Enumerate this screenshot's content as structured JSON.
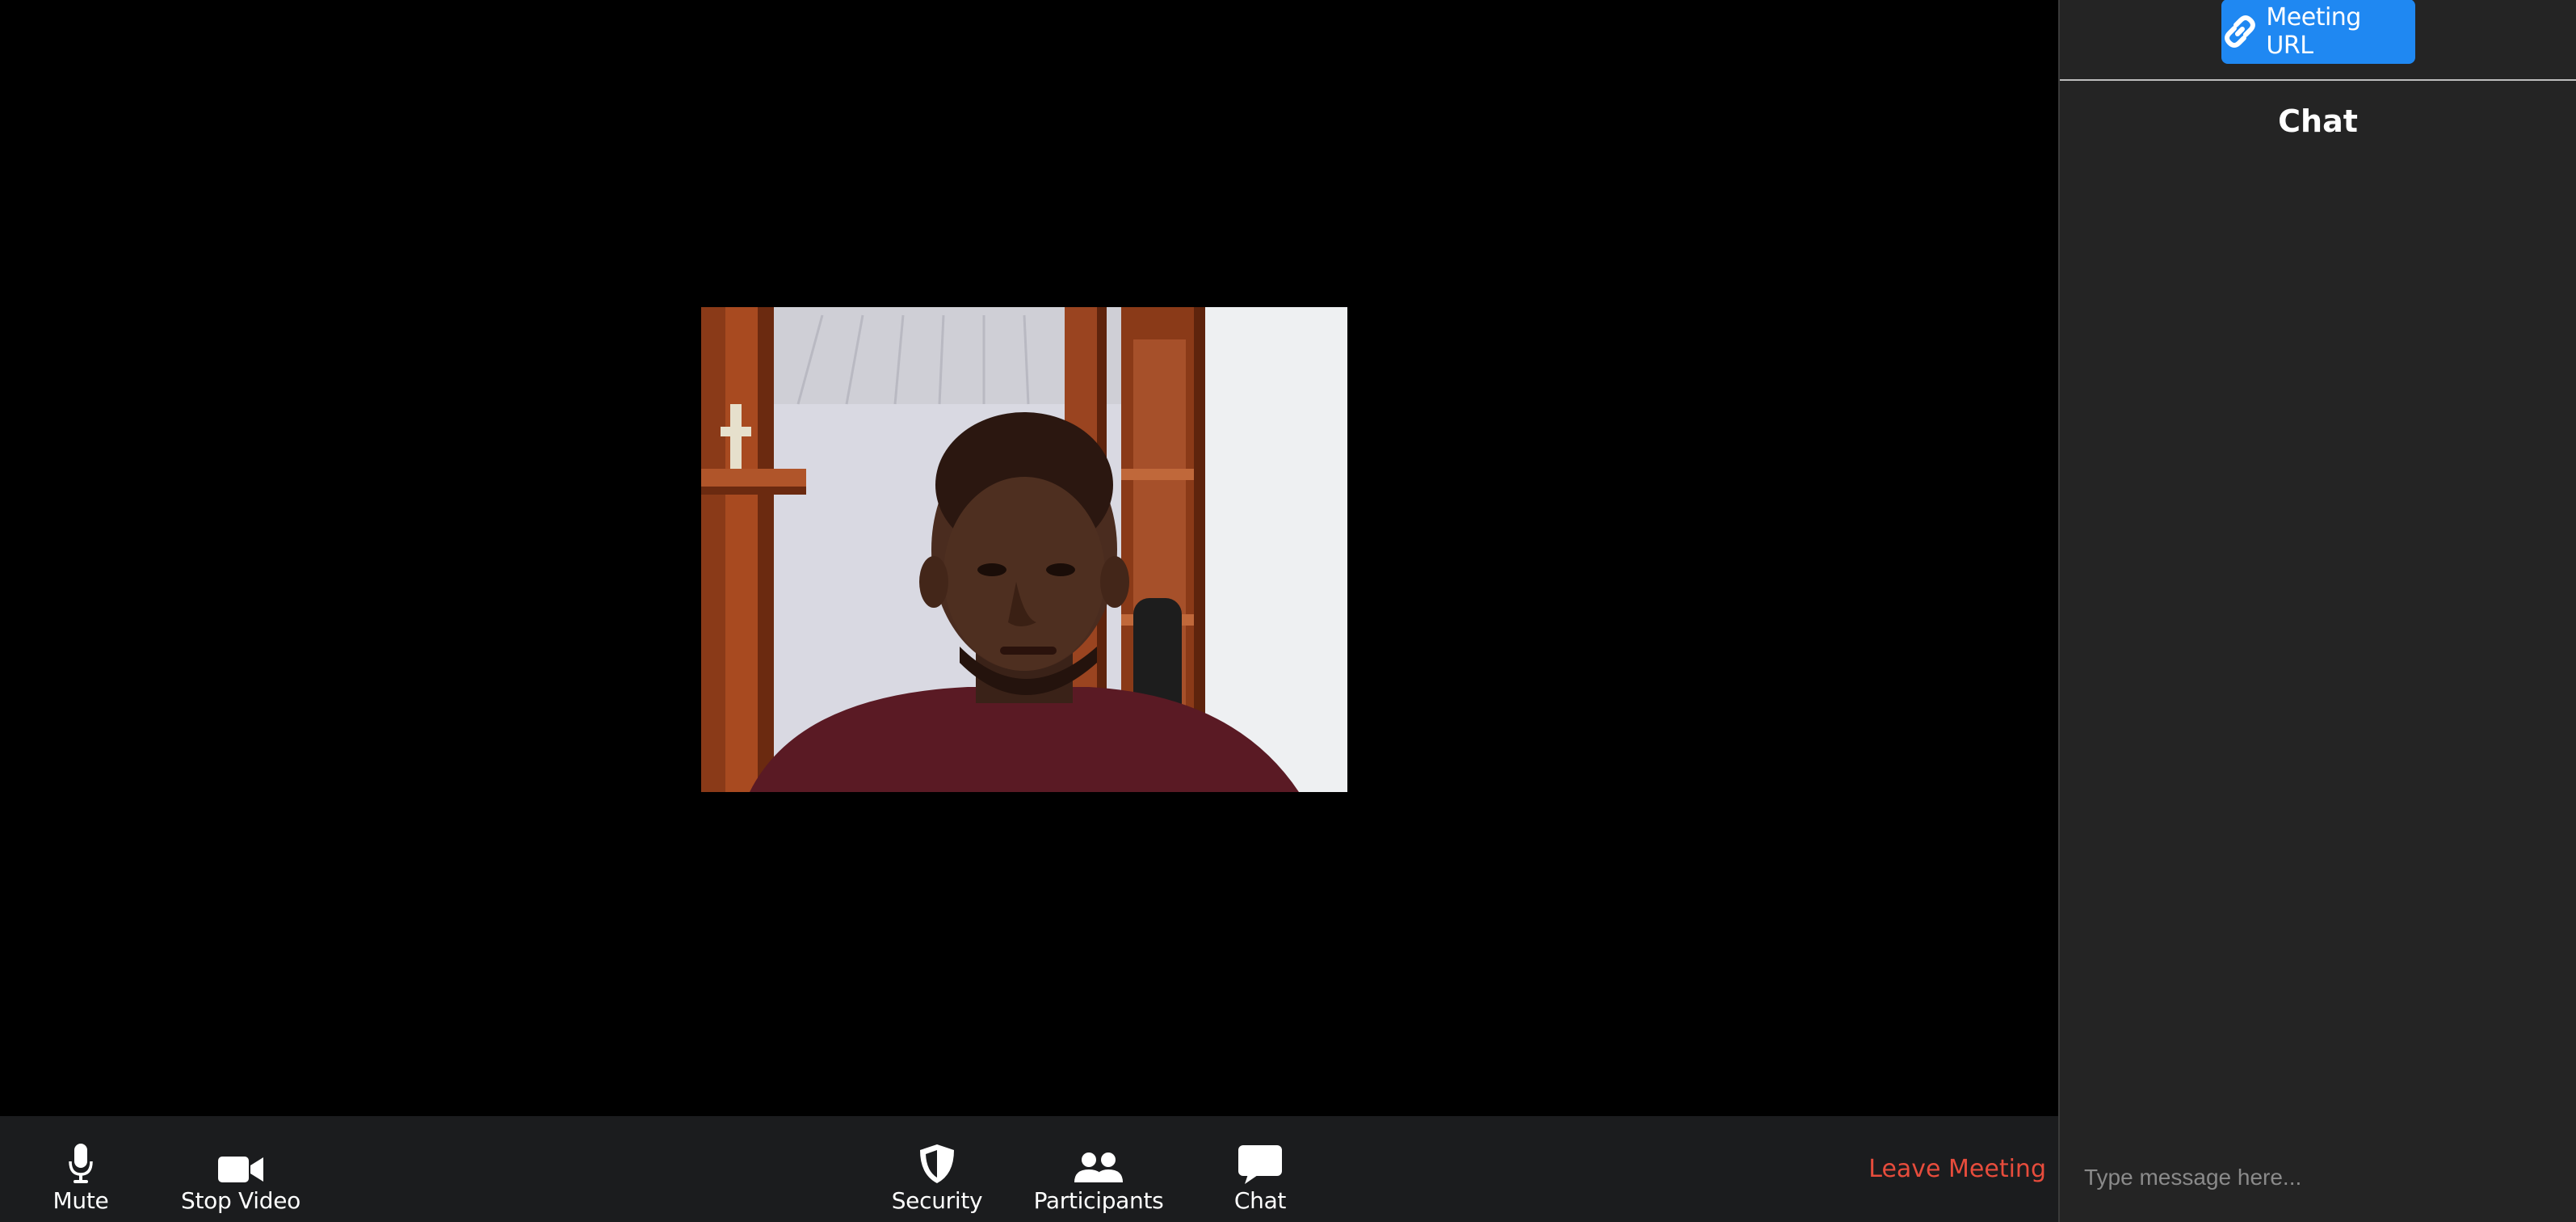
{
  "toolbar": {
    "left": [
      {
        "label": "Mute",
        "icon": "microphone-icon"
      },
      {
        "label": "Stop Video",
        "icon": "video-camera-icon"
      }
    ],
    "center": [
      {
        "label": "Security",
        "icon": "shield-icon"
      },
      {
        "label": "Participants",
        "icon": "users-icon"
      },
      {
        "label": "Chat",
        "icon": "chat-bubble-icon"
      }
    ],
    "leave_label": "Leave Meeting",
    "leave_color": "#e74c3c"
  },
  "panel": {
    "meeting_url_label": "Meeting URL",
    "meeting_url_icon": "link-icon",
    "meeting_url_color": "#1f88f2",
    "chat_title": "Chat",
    "input_placeholder": "Type message here..."
  },
  "video": {
    "tile_icon": "webcam-feed"
  }
}
